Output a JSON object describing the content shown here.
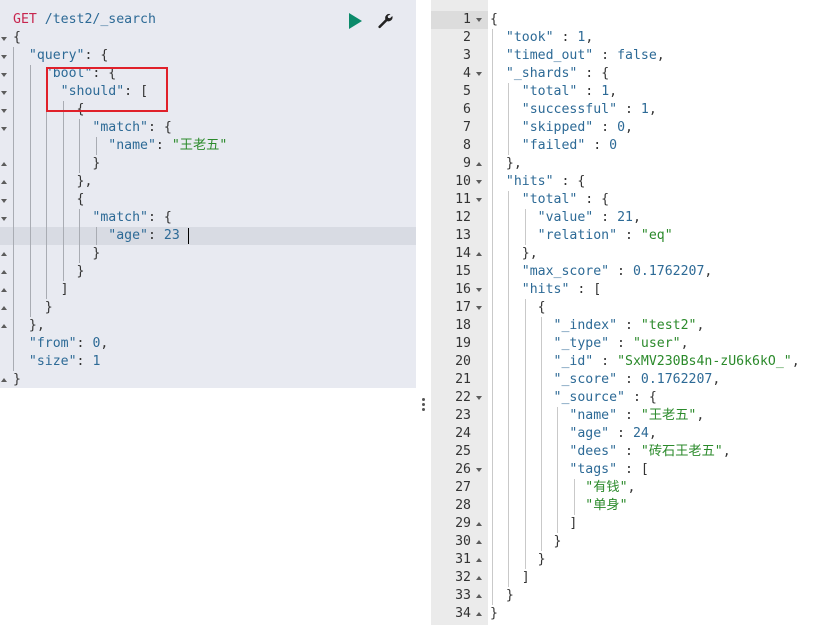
{
  "request": {
    "method": "GET",
    "path": "/test2/_search",
    "lines": [
      "{",
      "  \"query\": {",
      "    \"bool\": {",
      "      \"should\": [",
      "        {",
      "          \"match\": {",
      "            \"name\": \"王老五\"",
      "          }",
      "        },",
      "        {",
      "          \"match\": {",
      "            \"age\": 23",
      "          }",
      "        }",
      "      ]",
      "    }",
      "  },",
      "  \"from\": 0,",
      "  \"size\": 1",
      "}"
    ],
    "run_icon": "play-icon",
    "settings_icon": "wrench-icon"
  },
  "response": {
    "line_numbers": [
      "1",
      "2",
      "3",
      "4",
      "5",
      "6",
      "7",
      "8",
      "9",
      "10",
      "11",
      "12",
      "13",
      "14",
      "15",
      "16",
      "17",
      "18",
      "19",
      "20",
      "21",
      "22",
      "23",
      "24",
      "25",
      "26",
      "27",
      "28",
      "29",
      "30",
      "31",
      "32",
      "33",
      "34"
    ],
    "lines": [
      "{",
      "  \"took\" : 1,",
      "  \"timed_out\" : false,",
      "  \"_shards\" : {",
      "    \"total\" : 1,",
      "    \"successful\" : 1,",
      "    \"skipped\" : 0,",
      "    \"failed\" : 0",
      "  },",
      "  \"hits\" : {",
      "    \"total\" : {",
      "      \"value\" : 21,",
      "      \"relation\" : \"eq\"",
      "    },",
      "    \"max_score\" : 0.1762207,",
      "    \"hits\" : [",
      "      {",
      "        \"_index\" : \"test2\",",
      "        \"_type\" : \"user\",",
      "        \"_id\" : \"SxMV230Bs4n-zU6k6kO_\",",
      "        \"_score\" : 0.1762207,",
      "        \"_source\" : {",
      "          \"name\" : \"王老五\",",
      "          \"age\" : 24,",
      "          \"dees\" : \"砖石王老五\",",
      "          \"tags\" : [",
      "            \"有钱\",",
      "            \"单身\"",
      "          ]",
      "        }",
      "      }",
      "    ]",
      "  }",
      "}"
    ]
  },
  "colors": {
    "key": "#2d6a96",
    "string": "#2b8a2b",
    "method": "#c7254e",
    "run_button": "#0b8a6a",
    "highlight_box": "#e0202a",
    "request_background": "#e8eaf1"
  }
}
